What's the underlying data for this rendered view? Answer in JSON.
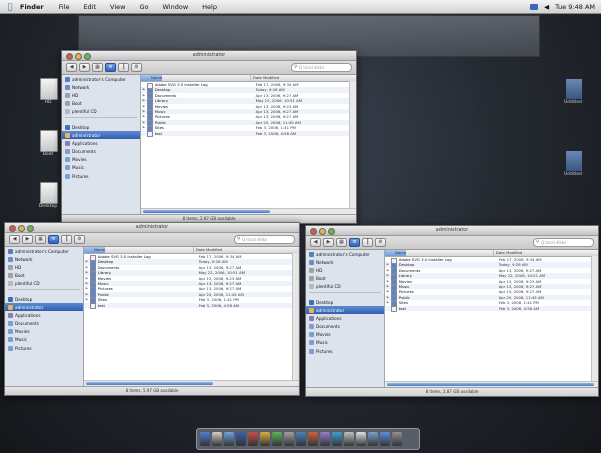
{
  "menubar": {
    "app": "Finder",
    "items": [
      "File",
      "Edit",
      "View",
      "Go",
      "Window",
      "Help"
    ],
    "clock": "Tue 9:48 AM"
  },
  "windows": [
    {
      "id": "top",
      "title": "administrator",
      "search_placeholder": "Q local disks",
      "status": "8 items, 2.87 GB available",
      "selected_sidebar": 6
    },
    {
      "id": "bottom-left",
      "title": "administrator",
      "search_placeholder": "Q local disks",
      "status": "8 items, 5.97 GB available",
      "selected_sidebar": 6
    },
    {
      "id": "bottom-right",
      "title": "administrator",
      "search_placeholder": "Q local disks",
      "status": "8 items, 2.87 GB available",
      "selected_sidebar": 6
    }
  ],
  "sidebar_items": [
    {
      "label": "administrator's Computer",
      "color": "#5a7fb8"
    },
    {
      "label": "Network",
      "color": "#6a8fc0"
    },
    {
      "label": "HD",
      "color": "#9aa2ad"
    },
    {
      "label": "Boot",
      "color": "#9aa2ad"
    },
    {
      "label": "plentiful CD",
      "color": "#b8b8b8"
    },
    {
      "label": "Desktop",
      "color": "#3f6fb5"
    },
    {
      "label": "administrator",
      "color": "#e8b45a"
    },
    {
      "label": "Applications",
      "color": "#8a7fb3"
    },
    {
      "label": "Documents",
      "color": "#7a9fd1"
    },
    {
      "label": "Movies",
      "color": "#7a9fd1"
    },
    {
      "label": "Music",
      "color": "#7a9fd1"
    },
    {
      "label": "Pictures",
      "color": "#7a9fd1"
    }
  ],
  "list_headers": {
    "name": "Name",
    "date": "Date Modified"
  },
  "files": [
    {
      "name": "Adobe SVG 3.0 Installer Log",
      "date": "Feb 17, 2006, 9:34 AM",
      "color": "#f2f2f2"
    },
    {
      "name": "Desktop",
      "date": "Today, 9:26 AM",
      "color": "#5d86c7"
    },
    {
      "name": "Documents",
      "date": "Apr 13, 2006, 9:27 AM",
      "color": "#5d86c7"
    },
    {
      "name": "Library",
      "date": "May 22, 2006, 10:51 AM",
      "color": "#5d86c7"
    },
    {
      "name": "Movies",
      "date": "Apr 13, 2006, 9:23 AM",
      "color": "#5d86c7"
    },
    {
      "name": "Music",
      "date": "Apr 13, 2006, 9:27 AM",
      "color": "#5d86c7"
    },
    {
      "name": "Pictures",
      "date": "Apr 13, 2006, 9:27 AM",
      "color": "#5d86c7"
    },
    {
      "name": "Public",
      "date": "Apr 20, 2006, 11:45 AM",
      "color": "#5d86c7"
    },
    {
      "name": "Sites",
      "date": "Feb 3, 2006, 1:41 PM",
      "color": "#5d86c7"
    },
    {
      "name": "test",
      "date": "Feb 3, 2006, 4:56 AM",
      "color": "#f2f2f2"
    }
  ],
  "desktop_icons": [
    "HD",
    "Boot",
    "Desktop",
    "Untitled",
    "Untitled"
  ],
  "dock_colors": [
    "#4f7ed0",
    "#d0d0d0",
    "#6fa3e0",
    "#3c5fa8",
    "#c94f4f",
    "#e0b040",
    "#5bb35b",
    "#a0a0a0",
    "#5080c0",
    "#d06040",
    "#8f7fcf",
    "#40a0d0",
    "#c0c0c0",
    "#e0e0e0",
    "#7aa0d0",
    "#5b8fe0",
    "#909090"
  ]
}
